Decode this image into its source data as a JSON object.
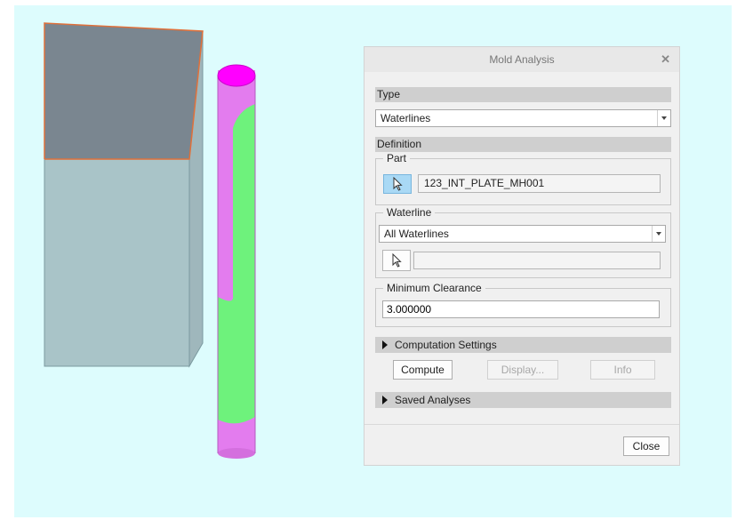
{
  "colors": {
    "viewport_bg": "#ddfcfd",
    "box_side": "#a9c4c8",
    "box_interior": "#7a8690",
    "box_edge": "#e0703a",
    "cyl_green": "#6ef27c",
    "cyl_pink": "#e37cee",
    "cyl_top": "#ff00ff",
    "select_active": "#a9d9f5"
  },
  "dialog": {
    "title": "Mold Analysis",
    "close_glyph": "✕",
    "type_section": "Type",
    "type_value": "Waterlines",
    "definition_section": "Definition",
    "part_group": "Part",
    "part_value": "123_INT_PLATE_MH001",
    "waterline_group": "Waterline",
    "waterline_value": "All Waterlines",
    "waterline_selection_value": "",
    "min_clearance_group": "Minimum Clearance",
    "min_clearance_value": "3.000000",
    "computation_settings": "Computation Settings",
    "compute": "Compute",
    "display": "Display...",
    "info": "Info",
    "saved_analyses": "Saved Analyses",
    "close": "Close"
  },
  "icons": {
    "part_selector": "cursor-arrow-icon",
    "waterline_selector": "cursor-arrow-icon",
    "computation_expander": "triangle-right-icon",
    "saved_expander": "triangle-right-icon"
  }
}
